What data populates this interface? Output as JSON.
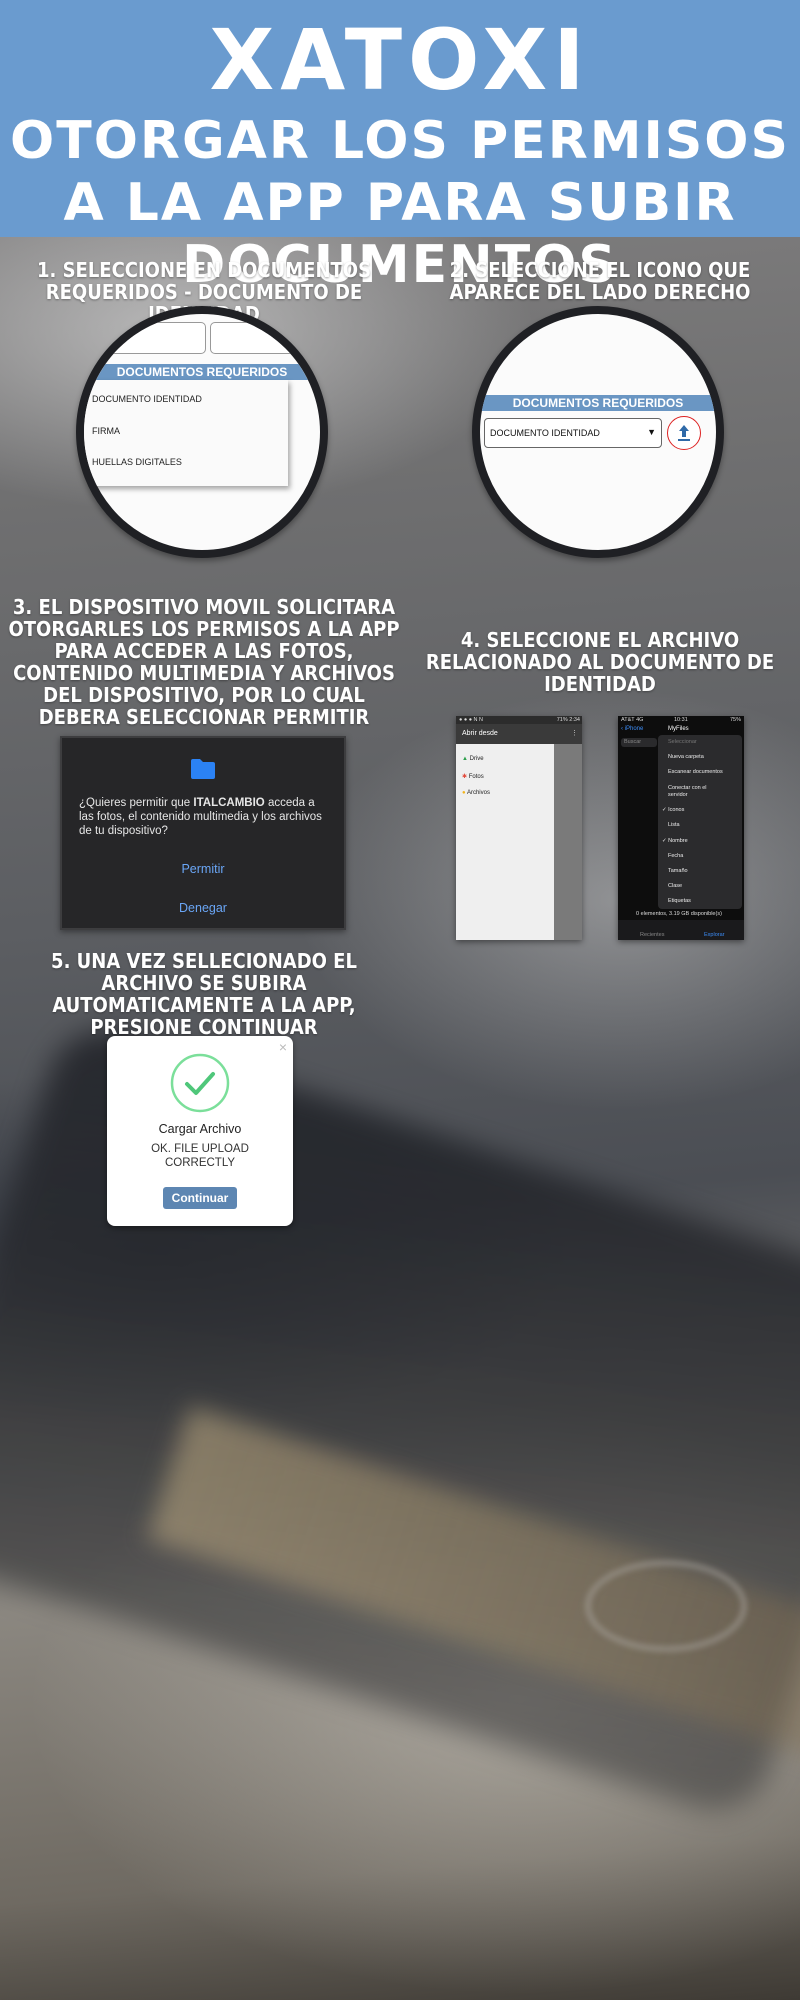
{
  "header": {
    "brand": "XATOXI",
    "subtitle": "OTORGAR LOS PERMISOS A LA APP PARA SUBIR DOCUMENTOS",
    "background_color": "#6a9bcf"
  },
  "step1": {
    "title": "1. SELECCIONE EN DOCUMENTOS REQUERIDOS - DOCUMENTO DE IDENTIDAD",
    "section_header": "DOCUMENTOS REQUERIDOS",
    "options": [
      "DOCUMENTO IDENTIDAD",
      "FIRMA",
      "HUELLAS DIGITALES"
    ]
  },
  "step2": {
    "title": "2. SELECCIONE EL ICONO QUE APARECE DEL LADO DERECHO",
    "section_header": "DOCUMENTOS REQUERIDOS",
    "selected_value": "DOCUMENTO IDENTIDAD",
    "upload_icon": "upload-icon"
  },
  "step3": {
    "title": "3. EL DISPOSITIVO MOVIL SOLICITARA OTORGARLES LOS PERMISOS A LA APP PARA ACCEDER A LAS FOTOS, CONTENIDO MULTIMEDIA Y ARCHIVOS DEL DISPOSITIVO, POR LO CUAL DEBERA SELECCIONAR PERMITIR",
    "dialog": {
      "icon": "folder-icon",
      "message_pre": "¿Quieres permitir que ",
      "app_name": "ITALCAMBIO",
      "message_post": " acceda a las fotos, el contenido multimedia y los archivos de tu dispositivo?",
      "allow_label": "Permitir",
      "deny_label": "Denegar"
    }
  },
  "step4": {
    "title": "4.  SELECCIONE EL ARCHIVO RELACIONADO AL DOCUMENTO DE IDENTIDAD",
    "android": {
      "status_time": "2:34",
      "status_battery": "71%",
      "title": "Abrir desde",
      "items": [
        "Drive",
        "Fotos",
        "Archivos"
      ]
    },
    "ios": {
      "status_carrier": "AT&T 4G",
      "status_time": "10:31",
      "status_battery": "75%",
      "back_label": "iPhone",
      "title": "MyFiles",
      "search_placeholder": "Buscar",
      "menu_items": [
        "Seleccionar",
        "Nueva carpeta",
        "Escanear documentos",
        "Conectar con el servidor",
        "Iconos",
        "Lista",
        "Nombre",
        "Fecha",
        "Tamaño",
        "Clase",
        "Etiquetas"
      ],
      "footer_text": "0 elementos, 3.19 GB disponible(s)",
      "tabs": [
        "Recientes",
        "Explorar"
      ]
    }
  },
  "step5": {
    "title": "5.  UNA VEZ SELLECIONADO EL ARCHIVO SE SUBIRA AUTOMATICAMENTE A LA APP, PRESIONE CONTINUAR",
    "card": {
      "check_icon": "check-circle-icon",
      "heading": "Cargar Archivo",
      "message": "OK. FILE UPLOAD CORRECTLY",
      "button_label": "Continuar",
      "close_icon": "close-icon"
    }
  }
}
